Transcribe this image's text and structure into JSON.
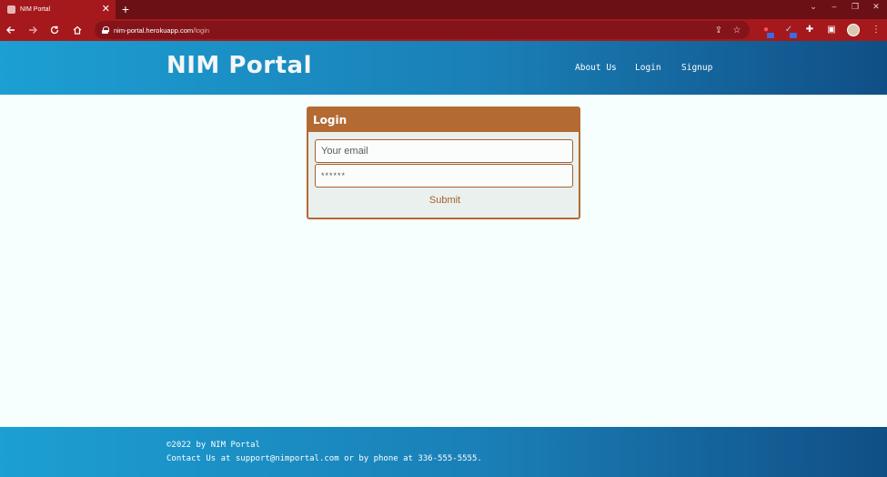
{
  "browser": {
    "tab_title": "NIM Portal",
    "tab_close": "✕",
    "new_tab": "+",
    "url_host": "nim-portal.herokuapp.com",
    "url_path": "/login",
    "window_controls": {
      "tab_search": "⌄",
      "minimize": "–",
      "restore": "❐",
      "close": "✕"
    }
  },
  "header": {
    "brand": "NIM Portal",
    "nav": [
      {
        "label": "About Us"
      },
      {
        "label": "Login"
      },
      {
        "label": "Signup"
      }
    ]
  },
  "login": {
    "title": "Login",
    "email_placeholder": "Your email",
    "password_value": "******",
    "submit_label": "Submit"
  },
  "footer": {
    "copyright": "©2022 by NIM Portal",
    "contact": "Contact Us at support@nimportal.com or by phone at 336-555-5555."
  },
  "colors": {
    "chrome_tab_active": "#a5191c",
    "chrome_tabstrip": "#6b1014",
    "header_start": "#1c9fd3",
    "header_end": "#104f86",
    "card_accent": "#b46a33",
    "page_bg": "#f6fffd"
  },
  "icons": {
    "back": "arrow-left-icon",
    "forward": "arrow-right-icon",
    "reload": "reload-icon",
    "home": "home-icon",
    "lock": "lock-icon",
    "share": "share-icon",
    "bookmark": "star-icon",
    "extensions": "puzzle-icon",
    "side_panel": "side-panel-icon",
    "menu": "kebab-menu-icon"
  }
}
